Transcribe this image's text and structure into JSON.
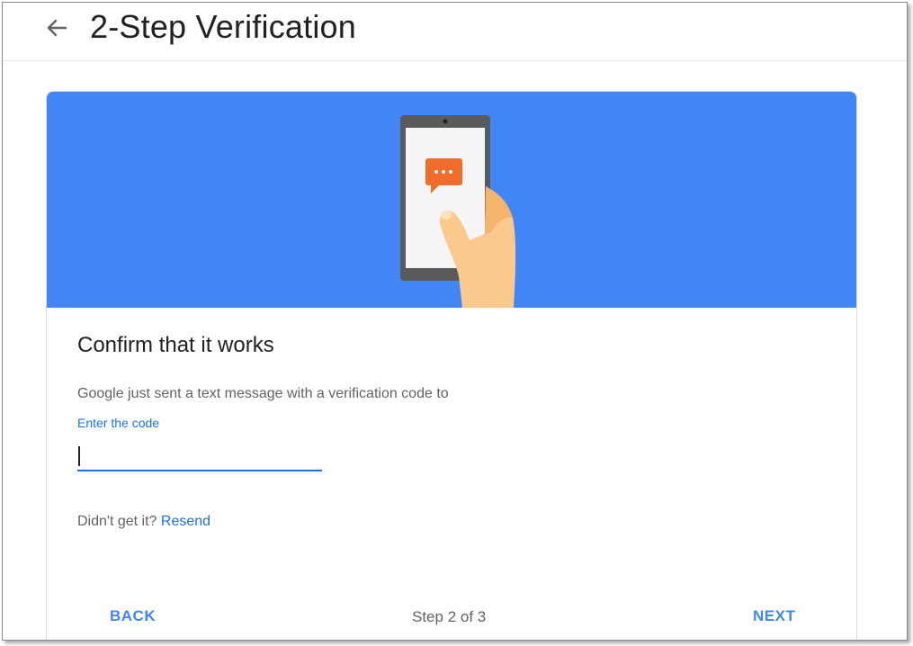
{
  "header": {
    "title": "2-Step Verification",
    "back_icon": "arrow-left-icon"
  },
  "banner": {
    "color": "#4285f4",
    "illustration": "phone-with-message-icon"
  },
  "card": {
    "heading": "Confirm that it works",
    "description": "Google just sent a text message with a verification code to",
    "code_field": {
      "label": "Enter the code",
      "value": ""
    },
    "resend": {
      "prompt": "Didn't get it?",
      "link": "Resend"
    },
    "footer": {
      "back_label": "BACK",
      "step_text": "Step 2 of 3",
      "next_label": "NEXT"
    }
  },
  "colors": {
    "accent": "#1a73e8",
    "button": "#4285f4",
    "text_primary": "#202124",
    "text_secondary": "#5f6368"
  }
}
